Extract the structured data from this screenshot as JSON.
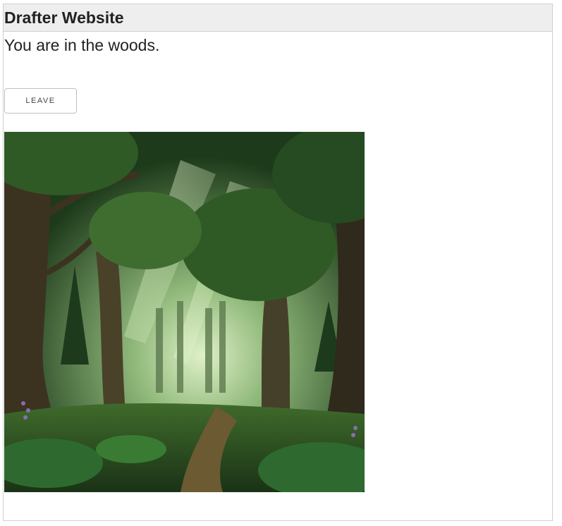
{
  "header": {
    "title": "Drafter Website"
  },
  "page": {
    "message": "You are in the woods.",
    "leave_button_label": "LEAVE",
    "image": {
      "icon": "forest-scene-image",
      "colors": {
        "canopy": "#2f5a26",
        "light": "#cfe8b0",
        "path": "#6b5a32",
        "trunk": "#3b3320"
      }
    }
  }
}
